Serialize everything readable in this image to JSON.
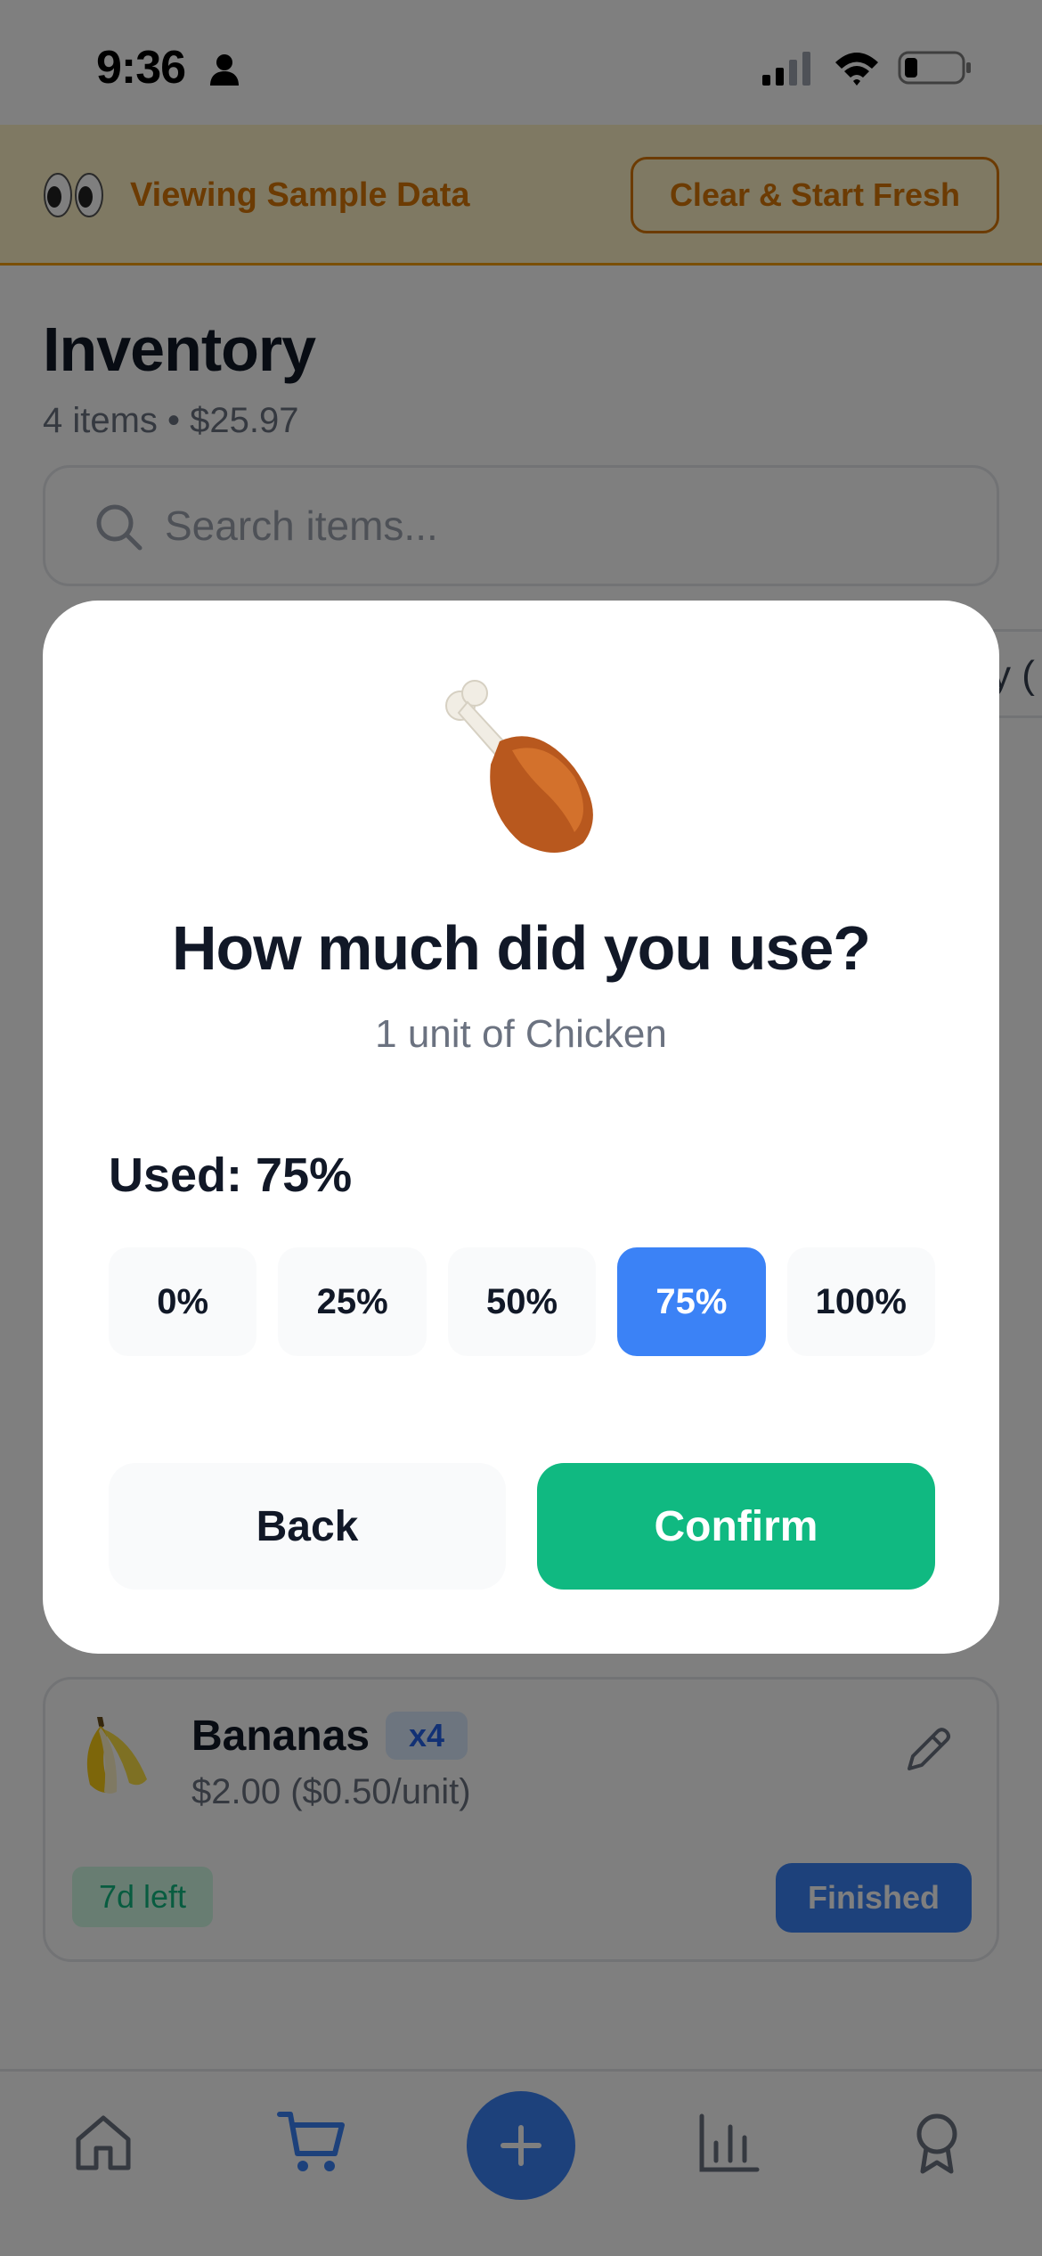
{
  "status_bar": {
    "time": "9:36"
  },
  "banner": {
    "text": "Viewing Sample Data",
    "clear_label": "Clear & Start Fresh",
    "icon": "eyes-icon"
  },
  "inventory": {
    "title": "Inventory",
    "summary": "4 items • $25.97",
    "search_placeholder": "Search items...",
    "category_chip": "y ("
  },
  "item_card": {
    "name": "Bananas",
    "quantity": "x4",
    "price": "$2.00 ($0.50/unit)",
    "days_left": "7d left",
    "finished_label": "Finished",
    "icon": "banana-icon"
  },
  "modal": {
    "icon": "chicken-leg-icon",
    "title": "How much did you use?",
    "subtitle": "1 unit of Chicken",
    "used_label": "Used: 75%",
    "options": [
      "0%",
      "25%",
      "50%",
      "75%",
      "100%"
    ],
    "selected_option": "75%",
    "back_label": "Back",
    "confirm_label": "Confirm"
  },
  "bottom_nav": {
    "items": [
      "home-icon",
      "cart-icon",
      "add-icon",
      "stats-icon",
      "awards-icon"
    ],
    "active": "cart-icon"
  },
  "colors": {
    "accent_blue": "#3b82f6",
    "confirm_green": "#10b981",
    "banner_amber": "#d97706",
    "banner_bg": "#fef3c7"
  }
}
